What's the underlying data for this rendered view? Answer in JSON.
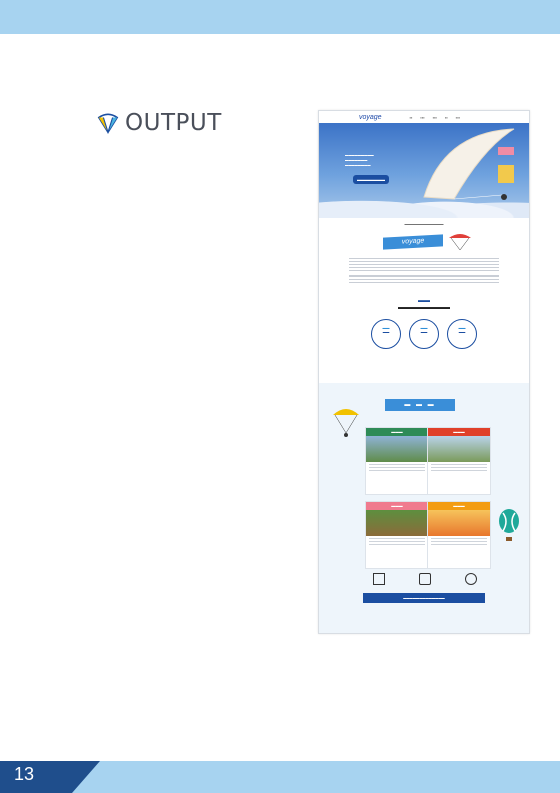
{
  "heading": {
    "title": "OUTPUT",
    "icon": "parachute-icon"
  },
  "page": {
    "number": "13"
  },
  "colors": {
    "band": "#a7d3f0",
    "dark_band": "#1f4e8c",
    "accent": "#1b4ea1"
  }
}
